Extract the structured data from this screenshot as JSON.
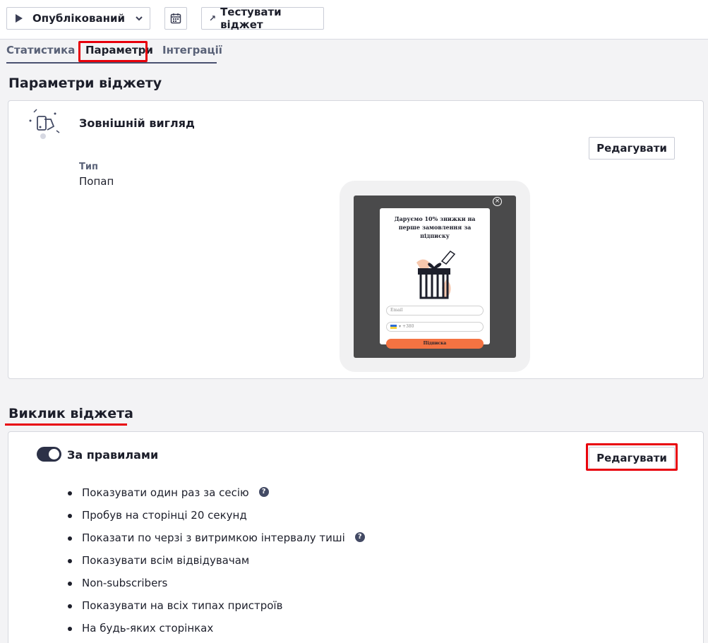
{
  "toolbar": {
    "status_label": "Опублікований",
    "test_label": "Тестувати віджет"
  },
  "tabs": [
    {
      "label": "Статистика"
    },
    {
      "label": "Параметри"
    },
    {
      "label": "Інтеграції"
    }
  ],
  "widget_params": {
    "section_title": "Параметри віджету",
    "appearance_title": "Зовнішній вигляд",
    "edit_label": "Редагувати",
    "type_label": "Тип",
    "type_value": "Попап"
  },
  "preview": {
    "close_symbol": "×",
    "title": "Даруємо 10% знижки на перше замовлення за підписку",
    "email_placeholder": "Email",
    "phone_prefix": "+380",
    "phone_flag_chevron": "▾",
    "submit_label": "Підписка"
  },
  "widget_call": {
    "section_title": "Виклик віджета",
    "mode_label": "За правилами",
    "edit_label": "Редагувати",
    "toggle_on": true,
    "help_symbol": "?",
    "rules": [
      "Показувати один раз за сесію",
      "Пробув на сторінці 20 секунд",
      "Показати по черзі з витримкою інтервалу тиші",
      "Показувати всім відвідувачам",
      "Non-subscribers",
      "Показувати на всіх типах пристроїв",
      "На будь-яких сторінках"
    ]
  },
  "colors": {
    "highlight": "#e8000b",
    "accent_dark": "#2c3147",
    "submit_orange": "#f47342"
  }
}
